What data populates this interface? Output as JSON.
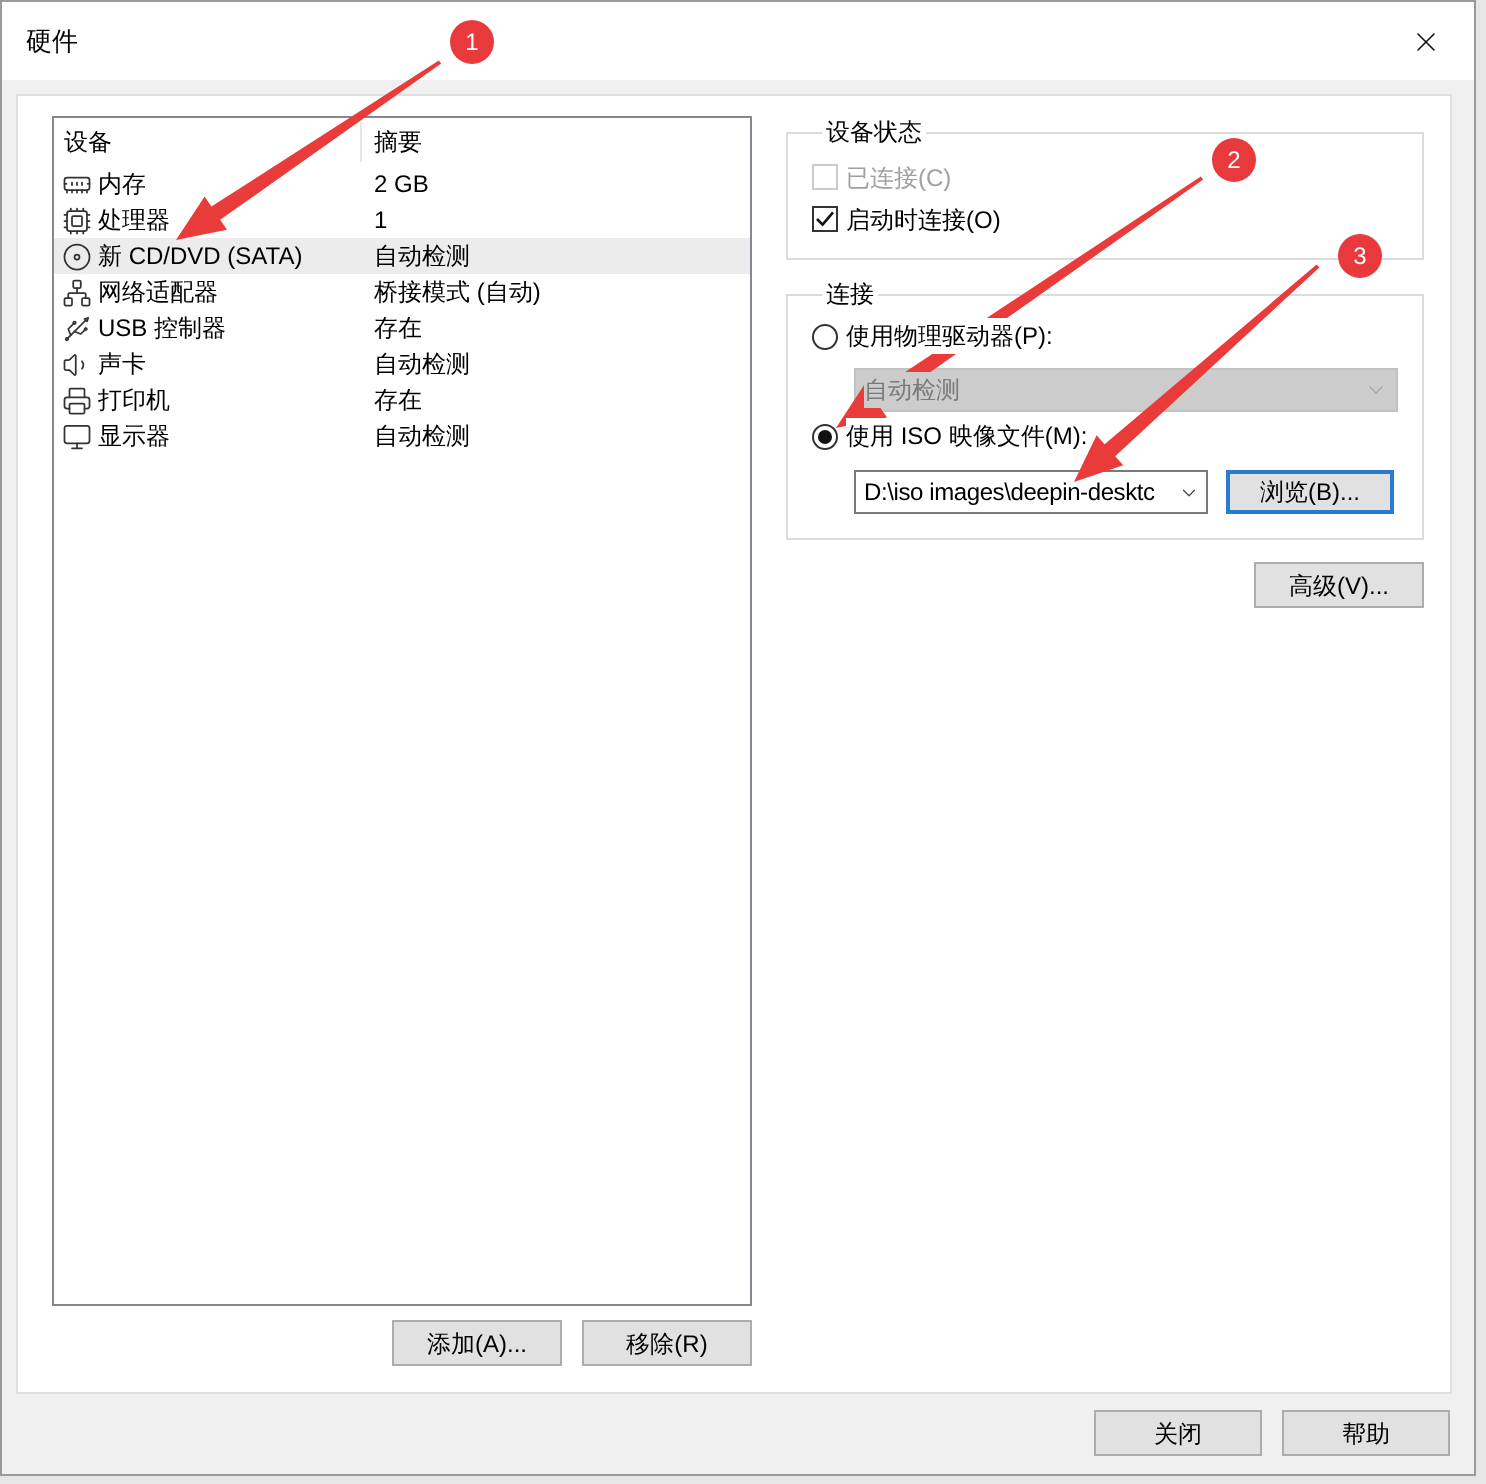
{
  "window": {
    "title": "硬件"
  },
  "device_list": {
    "columns": [
      "设备",
      "摘要"
    ],
    "rows": [
      {
        "kind": "memory",
        "device": "内存",
        "summary": "2 GB",
        "selected": false
      },
      {
        "kind": "processor",
        "device": "处理器",
        "summary": "1",
        "selected": false
      },
      {
        "kind": "cd",
        "device": "新 CD/DVD (SATA)",
        "summary": "自动检测",
        "selected": true
      },
      {
        "kind": "network",
        "device": "网络适配器",
        "summary": "桥接模式 (自动)",
        "selected": false
      },
      {
        "kind": "usb",
        "device": "USB 控制器",
        "summary": "存在",
        "selected": false
      },
      {
        "kind": "sound",
        "device": "声卡",
        "summary": "自动检测",
        "selected": false
      },
      {
        "kind": "printer",
        "device": "打印机",
        "summary": "存在",
        "selected": false
      },
      {
        "kind": "display",
        "device": "显示器",
        "summary": "自动检测",
        "selected": false
      }
    ]
  },
  "list_buttons": [
    "添加(A)...",
    "移除(R)"
  ],
  "device_status": {
    "title": "设备状态",
    "checkboxes": [
      {
        "label": "已连接(C)",
        "checked": false,
        "disabled": true
      },
      {
        "label": "启动时连接(O)",
        "checked": true,
        "disabled": false
      }
    ]
  },
  "connection": {
    "title": "连接",
    "options": [
      {
        "label": "使用物理驱动器(P):",
        "selected": false,
        "control": {
          "kind": "dropdown",
          "value": "自动检测",
          "disabled": true
        }
      },
      {
        "label": "使用 ISO 映像文件(M):",
        "selected": true,
        "control": {
          "kind": "combo",
          "value": "D:\\iso images\\deepin-desktc",
          "disabled": false,
          "button": {
            "label": "浏览(B)...",
            "focused": true
          }
        }
      }
    ]
  },
  "advanced_button": "高级(V)...",
  "footer_buttons": [
    "关闭",
    "帮助"
  ],
  "annotations": [
    {
      "label": "1"
    },
    {
      "label": "2"
    },
    {
      "label": "3"
    }
  ]
}
